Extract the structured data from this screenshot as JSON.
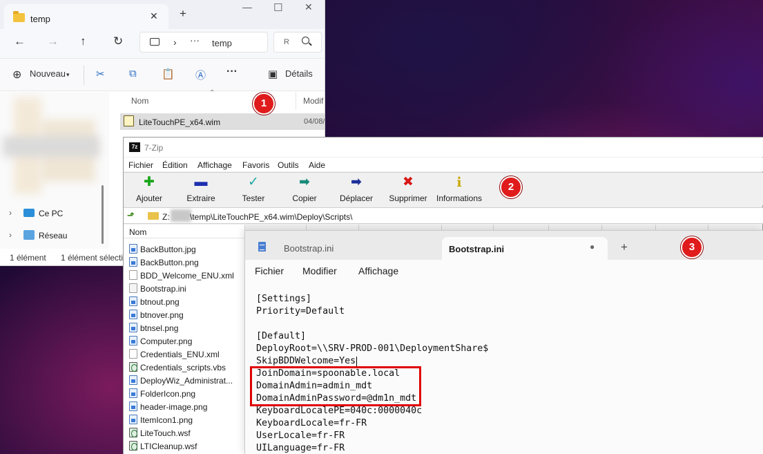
{
  "explorer": {
    "tab_title": "temp",
    "address_path": "temp",
    "search_placeholder": "R",
    "toolbar": {
      "new_label": "Nouveau",
      "details_label": "Détails"
    },
    "columns": {
      "name": "Nom",
      "modified": "Modif"
    },
    "files": [
      {
        "name": "LiteTouchPE_x64.wim",
        "modified": "04/08/"
      }
    ],
    "nav": [
      {
        "label": "Ce PC",
        "icon": "computer-icon"
      },
      {
        "label": "Réseau",
        "icon": "network-icon"
      }
    ],
    "status": {
      "count": "1 élément",
      "selected": "1 élément sélectio"
    }
  },
  "sevenzip": {
    "title": "7-Zip",
    "logo_text": "7z",
    "menu": [
      "Fichier",
      "Édition",
      "Affichage",
      "Favoris",
      "Outils",
      "Aide"
    ],
    "toolbar": [
      {
        "label": "Ajouter",
        "icon": "plus-icon",
        "color": "#1aa51a",
        "glyph": "✚"
      },
      {
        "label": "Extraire",
        "icon": "minus-icon",
        "color": "#1d2fb0",
        "glyph": "▬"
      },
      {
        "label": "Tester",
        "icon": "test-check-icon",
        "color": "#1aa5a5",
        "glyph": "✓"
      },
      {
        "label": "Copier",
        "icon": "copy-arrow-icon",
        "color": "#1a8a7a",
        "glyph": "➡"
      },
      {
        "label": "Déplacer",
        "icon": "move-arrow-icon",
        "color": "#1d2f9a",
        "glyph": "➡"
      },
      {
        "label": "Supprimer",
        "icon": "delete-x-icon",
        "color": "#d81818",
        "glyph": "✖"
      },
      {
        "label": "Informations",
        "icon": "info-icon",
        "color": "#c8a800",
        "glyph": "i"
      }
    ],
    "path_prefix": "Z:",
    "path": "\\temp\\LiteTouchPE_x64.wim\\Deploy\\Scripts\\",
    "list_header": "Nom",
    "files": [
      {
        "name": "BackButton.jpg",
        "type": "img"
      },
      {
        "name": "BackButton.png",
        "type": "img"
      },
      {
        "name": "BDD_Welcome_ENU.xml",
        "type": "xml"
      },
      {
        "name": "Bootstrap.ini",
        "type": "ini"
      },
      {
        "name": "btnout.png",
        "type": "img"
      },
      {
        "name": "btnover.png",
        "type": "img"
      },
      {
        "name": "btnsel.png",
        "type": "img"
      },
      {
        "name": "Computer.png",
        "type": "img"
      },
      {
        "name": "Credentials_ENU.xml",
        "type": "xml"
      },
      {
        "name": "Credentials_scripts.vbs",
        "type": "vbs"
      },
      {
        "name": "DeployWiz_Administrat...",
        "type": "img"
      },
      {
        "name": "FolderIcon.png",
        "type": "img"
      },
      {
        "name": "header-image.png",
        "type": "img"
      },
      {
        "name": "ItemIcon1.png",
        "type": "img"
      },
      {
        "name": "LiteTouch.wsf",
        "type": "vbs"
      },
      {
        "name": "LTICleanup.wsf",
        "type": "vbs"
      }
    ]
  },
  "notepad": {
    "tabs": [
      "Bootstrap.ini",
      "Bootstrap.ini"
    ],
    "unsaved_dot": "●",
    "menu": [
      "Fichier",
      "Modifier",
      "Affichage"
    ],
    "lines": [
      "[Settings]",
      "Priority=Default",
      "",
      "[Default]",
      "DeployRoot=\\\\SRV-PROD-001\\DeploymentShare$",
      "SkipBDDWelcome=Yes",
      "JoinDomain=spoonable.local",
      "DomainAdmin=admin_mdt",
      "DomainAdminPassword=@dm1n_mdt",
      "KeyboardLocalePE=040c:0000040c",
      "KeyboardLocale=fr-FR",
      "UserLocale=fr-FR",
      "UILanguage=fr-FR"
    ]
  },
  "badges": [
    "1",
    "2",
    "3"
  ],
  "colors": {
    "badge": "#e01b1b",
    "highlight_box": "#e00000"
  }
}
